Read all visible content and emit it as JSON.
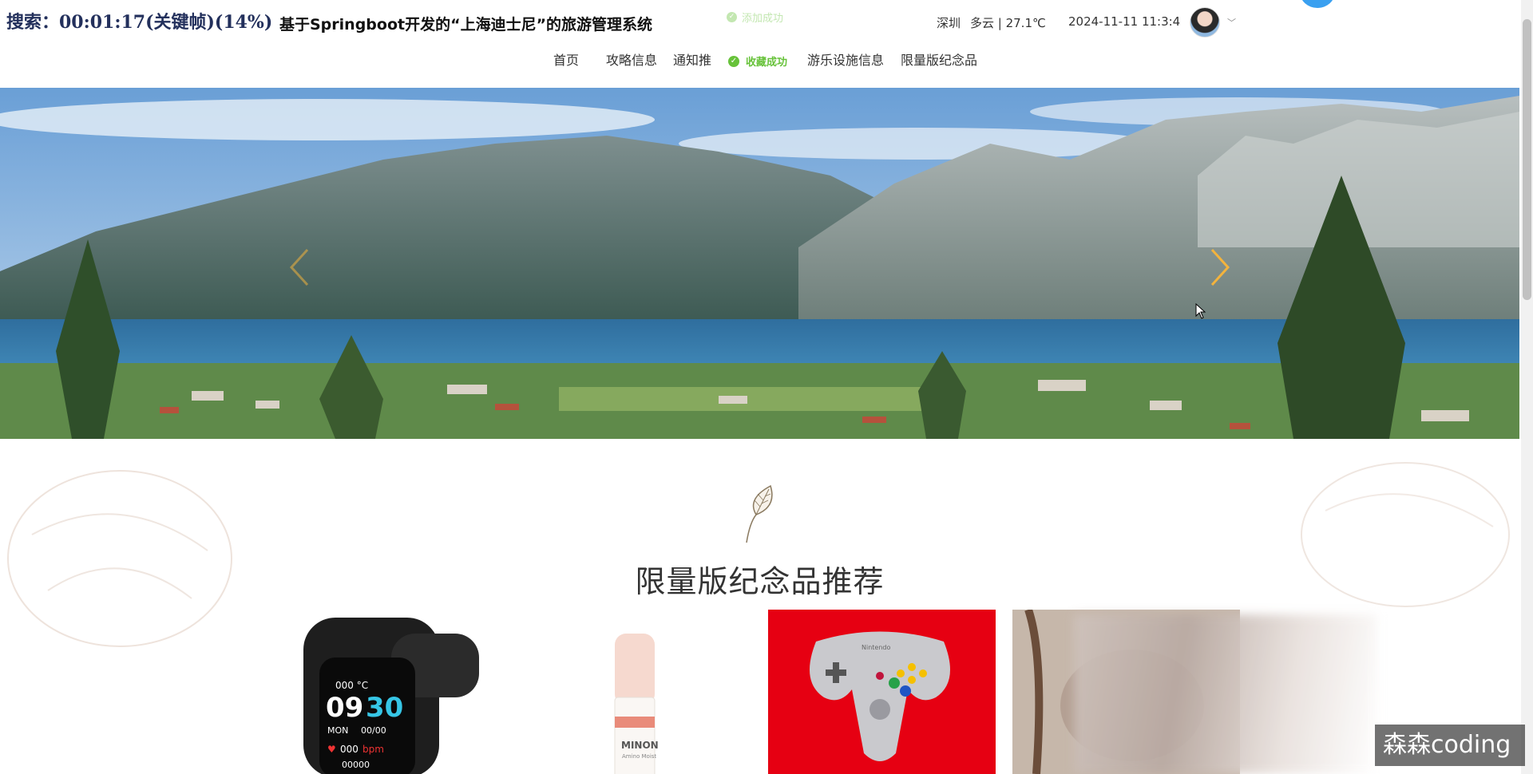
{
  "overlay": {
    "search_text": "搜索：00:01:17(关键帧)(14%)"
  },
  "header": {
    "title": "基于Springboot开发的“上海迪士尼”的旅游管理系统",
    "toast": "添加成功",
    "city": "深圳",
    "weather": "多云 | 27.1℃",
    "datetime": "2024-11-11   11:3:4"
  },
  "nav": {
    "items": [
      {
        "label": "首页",
        "active": true
      },
      {
        "label": "攻略信息"
      },
      {
        "label": "通知推"
      },
      {
        "label": "游乐设施信息"
      },
      {
        "label": "限量版纪念品"
      }
    ],
    "toast": "收藏成功"
  },
  "section": {
    "title": "限量版纪念品推荐"
  },
  "products": [
    {
      "name": "smartwatch",
      "watch_temp": "000 °C",
      "watch_time_h": "09",
      "watch_time_m": "30",
      "watch_day": "MON",
      "watch_date": "00/00",
      "watch_bpm_val": "000",
      "watch_bpm_unit": "bpm",
      "watch_steps": "00000"
    },
    {
      "name": "minon-bottle",
      "brand": "MINON",
      "sub": "Amino Moist"
    },
    {
      "name": "game-controller",
      "logo": "Nintendo"
    },
    {
      "name": "souvenir-4"
    }
  ],
  "watermark": "森森coding",
  "colors": {
    "accent": "#f3b33d",
    "success": "#67c23a",
    "controller_bg": "#e60012"
  }
}
